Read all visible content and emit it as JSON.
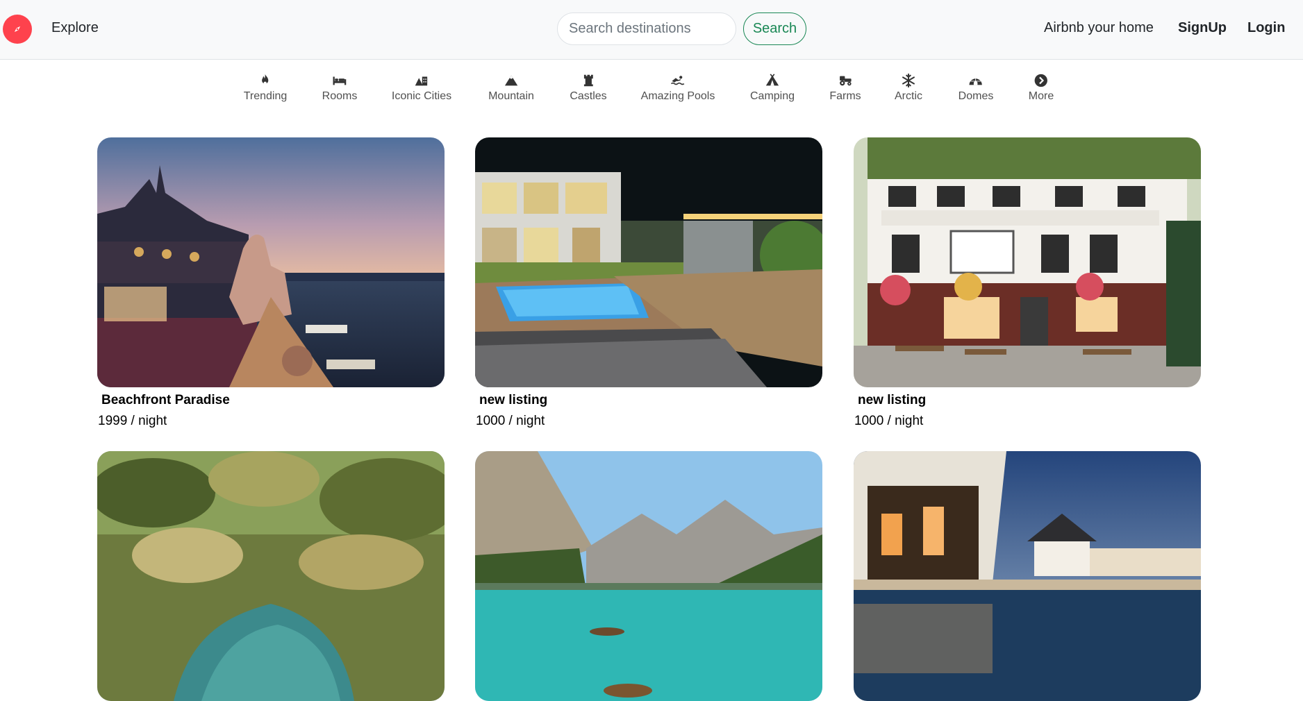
{
  "navbar": {
    "logo_icon": "compass-icon",
    "brand_color": "#fe424d",
    "explore_label": "Explore",
    "search_placeholder": "Search destinations",
    "search_button_label": "Search",
    "host_label": "Airbnb your home",
    "signup_label": "SignUp",
    "login_label": "Login"
  },
  "filters": [
    {
      "label": "Trending",
      "icon": "fire-icon"
    },
    {
      "label": "Rooms",
      "icon": "bed-icon"
    },
    {
      "label": "Iconic Cities",
      "icon": "city-icon"
    },
    {
      "label": "Mountain",
      "icon": "mountain-icon"
    },
    {
      "label": "Castles",
      "icon": "castle-icon"
    },
    {
      "label": "Amazing Pools",
      "icon": "swimmer-icon"
    },
    {
      "label": "Camping",
      "icon": "tent-icon"
    },
    {
      "label": "Farms",
      "icon": "tractor-icon"
    },
    {
      "label": "Arctic",
      "icon": "snowflake-icon"
    },
    {
      "label": "Domes",
      "icon": "igloo-icon"
    },
    {
      "label": "More",
      "icon": "chevron-right-circle-icon"
    }
  ],
  "listings": [
    {
      "title": "Beachfront Paradise",
      "price": "1999 / night",
      "image": "paris-rooftop-river-photo"
    },
    {
      "title": "new listing",
      "price": "1000 / night",
      "image": "modern-villa-pool-night-photo"
    },
    {
      "title": "new listing",
      "price": "1000 / night",
      "image": "english-pub-facade-photo"
    },
    {
      "title": "",
      "price": "",
      "image": "tropical-palm-river-photo"
    },
    {
      "title": "",
      "price": "",
      "image": "mountain-lake-boats-photo"
    },
    {
      "title": "",
      "price": "",
      "image": "resort-pool-dusk-photo"
    }
  ]
}
